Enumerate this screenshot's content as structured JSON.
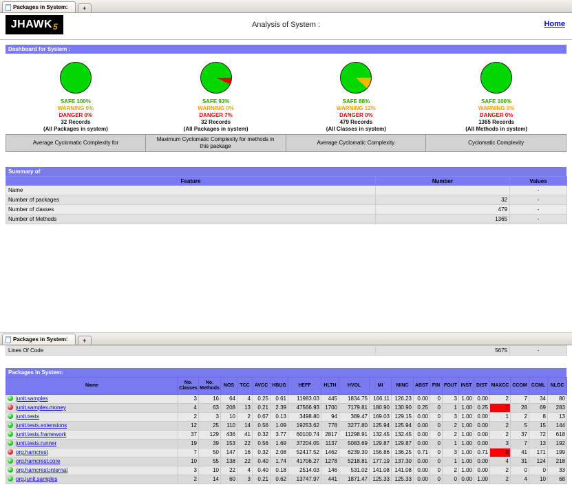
{
  "colors": {
    "accent": "#7a7af0",
    "safe": "#00d800",
    "warning": "#ffb400",
    "danger": "#ee0000",
    "danger_cell": "#ff0000",
    "link": "#0000cc"
  },
  "tab_bar": {
    "tab_label": "Packages in System:",
    "new_tab_label": "+"
  },
  "header": {
    "logo_text": "JHAWK",
    "logo_sub": "5",
    "title": "Analysis of System :",
    "home_link": "Home"
  },
  "dashboard": {
    "title": "Dashboard for System :",
    "gauges": [
      {
        "safe_label": "SAFE 100%",
        "warning_label": "WARNING 0%",
        "danger_label": "DANGER 0%",
        "records": "32 Records",
        "scope": "(All Packages in system)",
        "caption": "Average Cyclomatic Complexity for",
        "safe_pct": 100,
        "warning_pct": 0,
        "danger_pct": 0
      },
      {
        "safe_label": "SAFE 93%",
        "warning_label": "WARNING 0%",
        "danger_label": "DANGER 7%",
        "records": "32 Records",
        "scope": "(All Packages in system)",
        "caption": "Maximum Cyclomatic Complexity for methods in this package",
        "safe_pct": 93,
        "warning_pct": 0,
        "danger_pct": 7
      },
      {
        "safe_label": "SAFE 88%",
        "warning_label": "WARNING 12%",
        "danger_label": "DANGER 0%",
        "records": "479 Records",
        "scope": "(All Classes in system)",
        "caption": "Average Cyclomatic Complexity",
        "safe_pct": 88,
        "warning_pct": 12,
        "danger_pct": 0
      },
      {
        "safe_label": "SAFE 100%",
        "warning_label": "WARNING 0%",
        "danger_label": "DANGER 0%",
        "records": "1365 Records",
        "scope": "(All Methods in system)",
        "caption": "Cyclomatic Complexity",
        "safe_pct": 100,
        "warning_pct": 0,
        "danger_pct": 0
      }
    ]
  },
  "summary": {
    "title": "Summary of",
    "columns": [
      "Feature",
      "Number",
      "Values"
    ],
    "rows": [
      {
        "feature": "Name",
        "number": "",
        "values": "-"
      },
      {
        "feature": "Number of packages",
        "number": "32",
        "values": "-"
      },
      {
        "feature": "Number of classes",
        "number": "479",
        "values": "-"
      },
      {
        "feature": "Number of Methods",
        "number": "1365",
        "values": "-"
      }
    ],
    "lines_of_code_row": {
      "feature": "Lines Of Code",
      "number": "5675",
      "values": "-"
    }
  },
  "packages_table": {
    "title": "Packages in System:",
    "columns": [
      "Name",
      "No. Classes",
      "No. Methods",
      "NOS",
      "TCC",
      "AVCC",
      "HBUG",
      "HEFF",
      "HLTH",
      "HVOL",
      "MI",
      "MINC",
      "ABST",
      "FIN",
      "FOUT",
      "INST",
      "DIST",
      "MAXCC",
      "CCOM",
      "CCML",
      "NLOC"
    ],
    "rows": [
      {
        "status": "ok",
        "name": "junit.samples",
        "values": [
          "3",
          "16",
          "64",
          "4",
          "0.25",
          "0.61",
          "11983.03",
          "445",
          "1834.75",
          "166.11",
          "126.23",
          "0.00",
          "0",
          "3",
          "1.00",
          "0.00",
          "2",
          "7",
          "34",
          "80"
        ],
        "danger_cells": []
      },
      {
        "status": "danger",
        "name": "junit.samples.money",
        "values": [
          "4",
          "63",
          "208",
          "13",
          "0.21",
          "2.39",
          "47566.93",
          "1700",
          "7179.81",
          "180.90",
          "130.90",
          "0.25",
          "0",
          "1",
          "1.00",
          "0.25",
          "7",
          "28",
          "69",
          "283"
        ],
        "danger_cells": [
          16
        ]
      },
      {
        "status": "ok",
        "name": "junit.tests",
        "values": [
          "2",
          "3",
          "10",
          "2",
          "0.67",
          "0.13",
          "3498.80",
          "94",
          "389.47",
          "169.03",
          "129.15",
          "0.00",
          "0",
          "3",
          "1.00",
          "0.00",
          "1",
          "2",
          "8",
          "13"
        ],
        "danger_cells": []
      },
      {
        "status": "ok",
        "name": "junit.tests.extensions",
        "values": [
          "12",
          "25",
          "110",
          "14",
          "0.56",
          "1.09",
          "19253.62",
          "778",
          "3277.80",
          "125.94",
          "125.94",
          "0.00",
          "0",
          "2",
          "1.00",
          "0.00",
          "2",
          "5",
          "15",
          "144"
        ],
        "danger_cells": []
      },
      {
        "status": "ok",
        "name": "junit.tests.framework",
        "values": [
          "37",
          "129",
          "436",
          "41",
          "0.32",
          "3.77",
          "60100.74",
          "2817",
          "11298.91",
          "132.45",
          "132.45",
          "0.00",
          "0",
          "2",
          "1.00",
          "0.00",
          "2",
          "37",
          "72",
          "618"
        ],
        "danger_cells": []
      },
      {
        "status": "ok",
        "name": "junit.tests.runner",
        "values": [
          "19",
          "39",
          "153",
          "22",
          "0.56",
          "1.69",
          "37204.05",
          "1137",
          "5083.69",
          "129.87",
          "129.87",
          "0.00",
          "0",
          "1",
          "1.00",
          "0.00",
          "3",
          "7",
          "13",
          "192"
        ],
        "danger_cells": []
      },
      {
        "status": "danger",
        "name": "org.hamcrest",
        "values": [
          "7",
          "50",
          "147",
          "16",
          "0.32",
          "2.08",
          "52417.52",
          "1462",
          "6239.30",
          "156.86",
          "136.25",
          "0.71",
          "0",
          "3",
          "1.00",
          "0.71",
          "8",
          "41",
          "171",
          "199"
        ],
        "danger_cells": [
          16
        ]
      },
      {
        "status": "ok",
        "name": "org.hamcrest.core",
        "values": [
          "10",
          "55",
          "138",
          "22",
          "0.40",
          "1.74",
          "41706.27",
          "1278",
          "5218.81",
          "177.19",
          "137.30",
          "0.00",
          "0",
          "1",
          "1.00",
          "0.00",
          "4",
          "31",
          "124",
          "218"
        ],
        "danger_cells": []
      },
      {
        "status": "ok",
        "name": "org.hamcrest.internal",
        "values": [
          "3",
          "10",
          "22",
          "4",
          "0.40",
          "0.18",
          "2514.03",
          "146",
          "531.02",
          "141.08",
          "141.08",
          "0.00",
          "0",
          "2",
          "1.00",
          "0.00",
          "2",
          "0",
          "0",
          "33"
        ],
        "danger_cells": []
      },
      {
        "status": "ok",
        "name": "org.junit.samples",
        "values": [
          "2",
          "14",
          "60",
          "3",
          "0.21",
          "0.62",
          "13747.97",
          "441",
          "1871.47",
          "125.33",
          "125.33",
          "0.00",
          "0",
          "0",
          "0.00",
          "1.00",
          "2",
          "4",
          "10",
          "68"
        ],
        "danger_cells": []
      }
    ]
  }
}
